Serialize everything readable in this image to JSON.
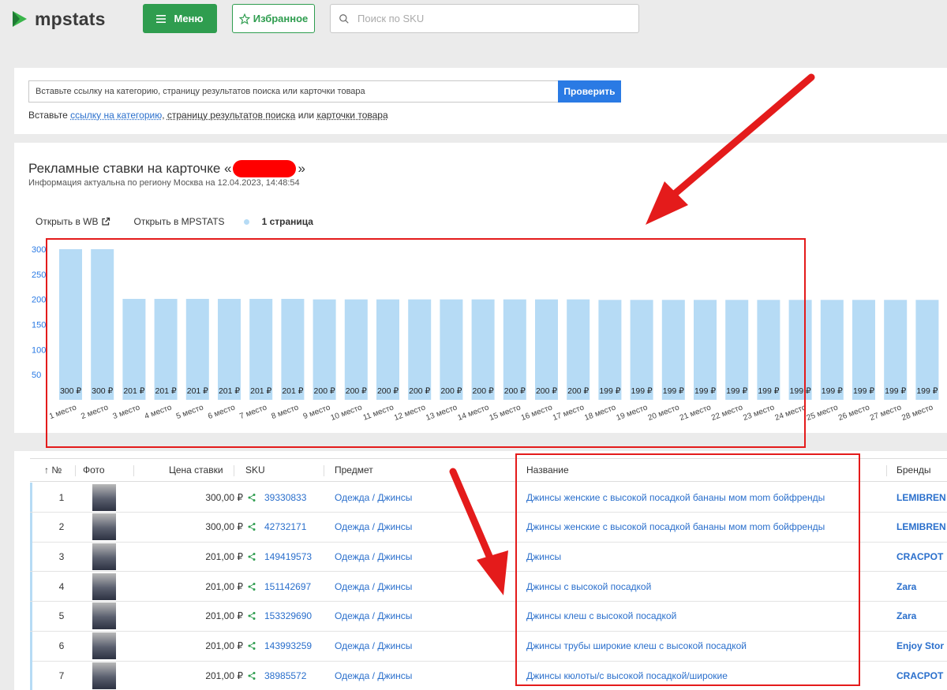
{
  "header": {
    "logo_text": "mpstats",
    "menu_label": "Меню",
    "favorites_label": "Избранное",
    "search_placeholder": "Поиск по SKU"
  },
  "url_panel": {
    "input_placeholder": "Вставьте ссылку на категорию, страницу результатов поиска или карточки товара",
    "check_label": "Проверить",
    "hint_prefix": "Вставьте ",
    "hint_link_category": "ссылку на категорию",
    "hint_sep1": ", ",
    "hint_link_search": "страницу результатов поиска",
    "hint_sep2": " или ",
    "hint_link_card": "карточки товара"
  },
  "chart_panel": {
    "title_prefix": "Рекламные ставки на карточке «",
    "title_suffix": "»",
    "subtitle": "Информация актуальна по региону Москва на 12.04.2023, 14:48:54",
    "open_wb": "Открыть в WB",
    "open_mpstats": "Открыть в MPSTATS",
    "legend_label": "1 страница"
  },
  "chart_data": {
    "type": "bar",
    "series": [
      {
        "name": "1 страница",
        "values": [
          300,
          300,
          201,
          201,
          201,
          201,
          201,
          201,
          200,
          200,
          200,
          200,
          200,
          200,
          200,
          200,
          200,
          199,
          199,
          199,
          199,
          199,
          199,
          199,
          199,
          199,
          199,
          199
        ]
      }
    ],
    "categories": [
      "1 место",
      "2 место",
      "3 место",
      "4 место",
      "5 место",
      "6 место",
      "7 место",
      "8 место",
      "9 место",
      "10 место",
      "11 место",
      "12 место",
      "13 место",
      "14 место",
      "15 место",
      "16 место",
      "17 место",
      "18 место",
      "19 место",
      "20 место",
      "21 место",
      "22 место",
      "23 место",
      "24 место",
      "25 место",
      "26 место",
      "27 место",
      "28 место"
    ],
    "values": [
      300,
      300,
      201,
      201,
      201,
      201,
      201,
      201,
      200,
      200,
      200,
      200,
      200,
      200,
      200,
      200,
      200,
      199,
      199,
      199,
      199,
      199,
      199,
      199,
      199,
      199,
      199,
      199
    ],
    "value_suffix": " ₽",
    "yticks": [
      "300",
      "250",
      "200",
      "150",
      "100",
      "50"
    ],
    "ylim": [
      0,
      300
    ],
    "color": "#b6dbf5"
  },
  "table": {
    "headers": {
      "num": "↑ №",
      "photo": "Фото",
      "price": "Цена ставки",
      "sku": "SKU",
      "subject": "Предмет",
      "name": "Название",
      "brand": "Бренды"
    },
    "rows": [
      {
        "num": "1",
        "price": "300,00 ₽",
        "sku": "39330833",
        "subject": "Одежда / Джинсы",
        "name": "Джинсы женские с высокой посадкой бананы мом mom бойфренды",
        "brand": "LEMIBREN"
      },
      {
        "num": "2",
        "price": "300,00 ₽",
        "sku": "42732171",
        "subject": "Одежда / Джинсы",
        "name": "Джинсы женские с высокой посадкой бананы мом mom бойфренды",
        "brand": "LEMIBREN"
      },
      {
        "num": "3",
        "price": "201,00 ₽",
        "sku": "149419573",
        "subject": "Одежда / Джинсы",
        "name": "Джинсы",
        "brand": "CRACPOT"
      },
      {
        "num": "4",
        "price": "201,00 ₽",
        "sku": "151142697",
        "subject": "Одежда / Джинсы",
        "name": "Джинсы с высокой посадкой",
        "brand": "Zara"
      },
      {
        "num": "5",
        "price": "201,00 ₽",
        "sku": "153329690",
        "subject": "Одежда / Джинсы",
        "name": "Джинсы клеш с высокой посадкой",
        "brand": "Zara"
      },
      {
        "num": "6",
        "price": "201,00 ₽",
        "sku": "143993259",
        "subject": "Одежда / Джинсы",
        "name": "Джинсы трубы широкие клеш с высокой посадкой",
        "brand": "Enjoy Stor"
      },
      {
        "num": "7",
        "price": "201,00 ₽",
        "sku": "38985572",
        "subject": "Одежда / Джинсы",
        "name": "Джинсы кюлоты/с высокой посадкой/широкие",
        "brand": "CRACPOT"
      }
    ]
  },
  "colors": {
    "brand_green": "#2f9d4f",
    "link_blue": "#2a6fcc",
    "button_blue": "#2a7ae4",
    "bar_blue": "#b6dbf5",
    "annotation_red": "#e41b1b"
  }
}
